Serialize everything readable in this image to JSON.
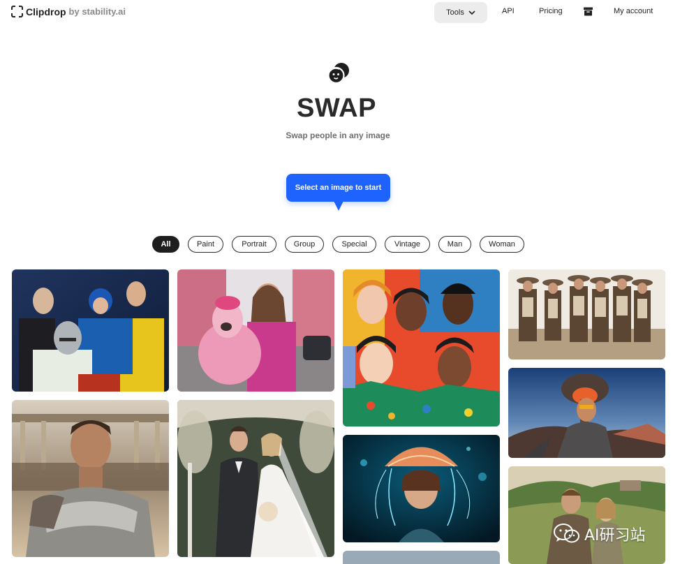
{
  "header": {
    "brand": "Clipdrop",
    "brand_sub": "by stability.ai",
    "nav": {
      "tools": "Tools",
      "api": "API",
      "pricing": "Pricing",
      "account": "My account"
    }
  },
  "hero": {
    "icon": "swap-face-icon",
    "title": "SWAP",
    "subtitle": "Swap people in any image",
    "cta": "Select an image to start"
  },
  "filters": [
    "All",
    "Paint",
    "Portrait",
    "Group",
    "Special",
    "Vintage",
    "Man",
    "Woman"
  ],
  "active_filter": "All",
  "gallery": [
    "retro-family-with-robot",
    "woman-with-pink-llama",
    "painted-group-portrait",
    "cowboys-group",
    "gladiator-in-arena",
    "wedding-couple",
    "woman-with-jellyfish-hat",
    "man-volcano-selfie",
    "vintage-couple-in-field",
    "partial-image"
  ],
  "watermark": {
    "text": "AI研习站",
    "icon": "wechat-icon"
  },
  "colors": {
    "accent": "#1f63ff",
    "chip_active": "#1e1e1e",
    "tools_bg": "#ececec"
  }
}
